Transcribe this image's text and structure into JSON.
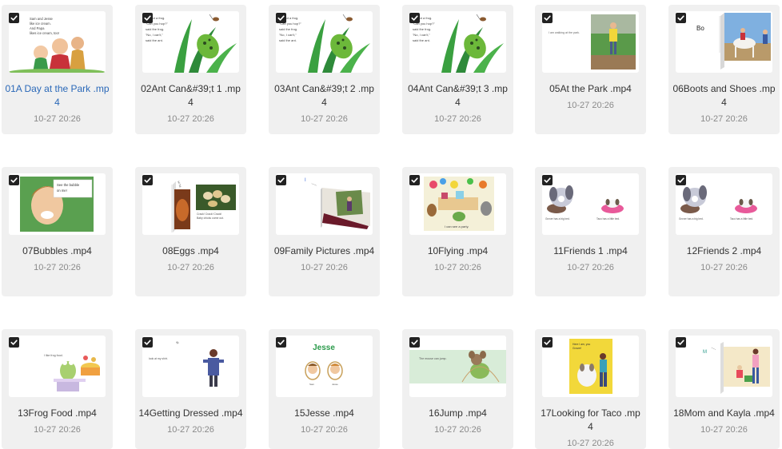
{
  "files": [
    {
      "name": "01A Day at the Park .mp4",
      "date": "10-27 20:26",
      "icon": "video-thumbnail",
      "checked": true
    },
    {
      "name": "02Ant Can&#39;t 1 .mp4",
      "date": "10-27 20:26",
      "icon": "video-thumbnail",
      "checked": true
    },
    {
      "name": "03Ant Can&#39;t 2 .mp4",
      "date": "10-27 20:26",
      "icon": "video-thumbnail",
      "checked": true
    },
    {
      "name": "04Ant Can&#39;t 3 .mp4",
      "date": "10-27 20:26",
      "icon": "video-thumbnail",
      "checked": true
    },
    {
      "name": "05At the Park .mp4",
      "date": "10-27 20:26",
      "icon": "video-thumbnail",
      "checked": true
    },
    {
      "name": "06Boots and Shoes .mp4",
      "date": "10-27 20:26",
      "icon": "video-thumbnail",
      "checked": true
    },
    {
      "name": "07Bubbles .mp4",
      "date": "10-27 20:26",
      "icon": "video-thumbnail",
      "checked": true
    },
    {
      "name": "08Eggs .mp4",
      "date": "10-27 20:26",
      "icon": "video-thumbnail",
      "checked": true
    },
    {
      "name": "09Family Pictures .mp4",
      "date": "10-27 20:26",
      "icon": "video-thumbnail",
      "checked": true
    },
    {
      "name": "10Flying .mp4",
      "date": "10-27 20:26",
      "icon": "video-thumbnail",
      "checked": true
    },
    {
      "name": "11Friends 1 .mp4",
      "date": "10-27 20:26",
      "icon": "video-thumbnail",
      "checked": true
    },
    {
      "name": "12Friends 2 .mp4",
      "date": "10-27 20:26",
      "icon": "video-thumbnail",
      "checked": true
    },
    {
      "name": "13Frog Food .mp4",
      "date": "10-27 20:26",
      "icon": "video-thumbnail",
      "checked": true
    },
    {
      "name": "14Getting Dressed .mp4",
      "date": "10-27 20:26",
      "icon": "video-thumbnail",
      "checked": true
    },
    {
      "name": "15Jesse .mp4",
      "date": "10-27 20:26",
      "icon": "video-thumbnail",
      "checked": true
    },
    {
      "name": "16Jump .mp4",
      "date": "10-27 20:26",
      "icon": "video-thumbnail",
      "checked": true
    },
    {
      "name": "17Looking for Taco .mp4",
      "date": "10-27 20:26",
      "icon": "video-thumbnail",
      "checked": true
    },
    {
      "name": "18Mom and Kayla .mp4",
      "date": "10-27 20:26",
      "icon": "video-thumbnail",
      "checked": true
    }
  ],
  "thumb_text": {
    "t02": [
      "I'm not a frog.",
      "\"Can you hop?\"",
      "said the frog.",
      "\"No, I can't,\"",
      "said the ant."
    ],
    "t05": "I am walking at the park.",
    "t06": "Bo",
    "t07": [
      "See the bubble",
      "on me!"
    ],
    "t08": [
      "Crack! Crack! Crack!",
      "Baby chicks come out."
    ],
    "t11": [
      "Grover has a big bed.",
      "Taco has a little bed."
    ],
    "t13": "I like frog food.",
    "t14": "look at my shirt.",
    "t15": "Jesse",
    "t16": "The mouse can jump.",
    "t17": [
      "Here I am, you",
      "Grover!"
    ],
    "t01": [
      "Sam and Jesse",
      "like ice cream.",
      "And Papa",
      "likes ice cream, too!"
    ],
    "t10": "I can see a party."
  },
  "colors": {
    "selected_name": "#2a68b8",
    "card_bg": "#f0f0f0",
    "check_bg": "#222222"
  }
}
